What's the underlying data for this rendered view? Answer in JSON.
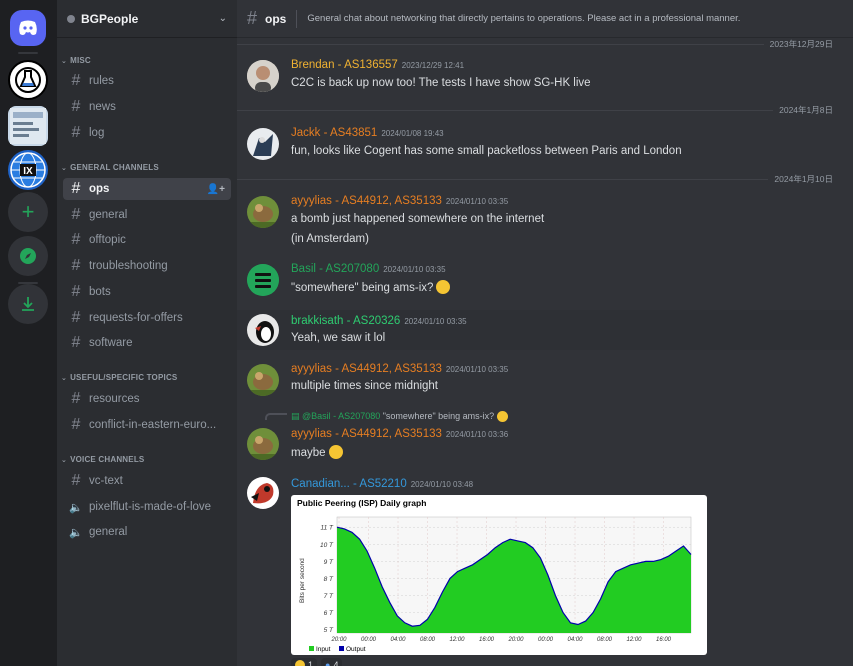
{
  "server": {
    "name": "BGPeople"
  },
  "categories": {
    "misc": "MISC",
    "general": "GENERAL CHANNELS",
    "useful": "USEFUL/SPECIFIC TOPICS",
    "voice": "VOICE CHANNELS"
  },
  "channels": {
    "misc": [
      "rules",
      "news",
      "log"
    ],
    "general": [
      "ops",
      "general",
      "offtopic",
      "troubleshooting",
      "bots",
      "requests-for-offers",
      "software"
    ],
    "useful": [
      "resources",
      "conflict-in-eastern-euro..."
    ],
    "voice_text": "vc-text",
    "voice": [
      "pixelflut-is-made-of-love",
      "general"
    ]
  },
  "topbar": {
    "channel": "ops",
    "topic": "General chat about networking that directly pertains to operations. Please act in a professional manner."
  },
  "dividers": [
    "2023年12月29日",
    "2024年1月8日",
    "2024年1月10日"
  ],
  "messages": [
    {
      "name": "Brendan - AS136557",
      "time": "2023/12/29 12:41",
      "text": "C2C is back up now too! The tests I have show SG-HK live",
      "color": "#f0b232"
    },
    {
      "name": "Jackk - AS43851",
      "time": "2024/01/08 19:43",
      "text": "fun, looks like Cogent has some small packetloss between Paris and London",
      "color": "#e67e22"
    },
    {
      "name": "ayyylias - AS44912, AS35133",
      "time": "2024/01/10 03:35",
      "text": "a bomb just happened somewhere on the internet",
      "text2": "(in Amsterdam)",
      "color": "#e67e22"
    },
    {
      "name": "Basil - AS207080",
      "time": "2024/01/10 03:35",
      "text": "\"somewhere\" being ams-ix?",
      "color": "#23a55a"
    },
    {
      "name": "brakkisath - AS20326",
      "time": "2024/01/10 03:35",
      "text": "Yeah, we saw it lol",
      "color": "#2ecc71"
    },
    {
      "name": "ayyylias - AS44912, AS35133",
      "time": "2024/01/10 03:35",
      "text": "multiple times since midnight",
      "color": "#e67e22"
    },
    {
      "name": "ayyylias - AS44912, AS35133",
      "time": "2024/01/10 03:36",
      "text": "maybe",
      "color": "#e67e22",
      "reply_name": "@Basil - AS207080",
      "reply_text": "\"somewhere\" being ams-ix?"
    },
    {
      "name": "Canadian... - AS52210",
      "time": "2024/01/10 03:48",
      "text": "",
      "color": "#3498db"
    }
  ],
  "graph": {
    "title": "Public Peering (ISP) Daily graph",
    "ylabel": "Bits per second",
    "yticks": [
      "11 T",
      "10 T",
      "9 T",
      "8 T",
      "7 T",
      "6 T",
      "5 T"
    ],
    "xticks": [
      "20:00",
      "00:00",
      "04:00",
      "08:00",
      "12:00",
      "16:00",
      "20:00",
      "00:00",
      "04:00",
      "08:00",
      "12:00",
      "16:00"
    ],
    "legend": [
      "Input",
      "Output"
    ],
    "colors": {
      "input": "#22cc22",
      "output": "#0000aa"
    }
  },
  "chart_data": {
    "type": "area",
    "title": "Public Peering (ISP) Daily graph",
    "ylabel": "Bits per second",
    "ylim": [
      4.8,
      11.6
    ],
    "x": [
      0,
      1,
      2,
      3,
      4,
      5,
      6,
      7,
      8,
      9,
      10,
      11,
      12,
      13,
      14,
      15,
      16,
      17,
      18,
      19,
      20,
      21,
      22,
      23,
      24,
      25,
      26,
      27,
      28,
      29,
      30,
      31,
      32,
      33,
      34,
      35,
      36,
      37,
      38,
      39,
      40,
      41,
      42,
      43,
      44,
      45,
      46,
      47
    ],
    "series": [
      {
        "name": "Input",
        "values": [
          11.0,
          10.9,
          10.7,
          10.3,
          9.6,
          8.6,
          7.5,
          6.6,
          5.8,
          5.4,
          5.2,
          5.25,
          5.6,
          6.3,
          7.2,
          8.0,
          8.4,
          8.6,
          8.8,
          9.1,
          9.4,
          9.8,
          10.1,
          10.3,
          10.2,
          10.1,
          9.8,
          9.2,
          8.2,
          7.0,
          6.0,
          5.4,
          5.3,
          5.5,
          6.0,
          6.8,
          7.8,
          8.4,
          8.6,
          8.8,
          8.9,
          9.0,
          9.0,
          9.1,
          9.3,
          9.6,
          9.9,
          9.4
        ]
      }
    ]
  }
}
